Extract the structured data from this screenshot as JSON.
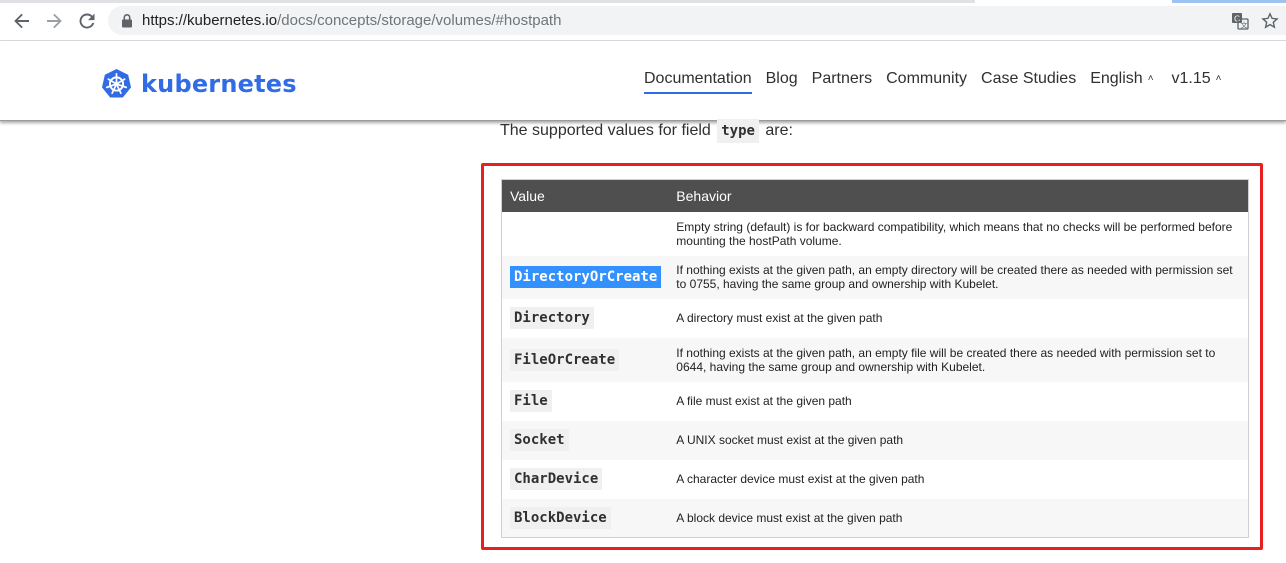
{
  "browser": {
    "url_host": "https://kubernetes.io",
    "url_path": "/docs/concepts/storage/volumes/#hostpath",
    "icons": [
      "back-arrow-icon",
      "forward-arrow-icon",
      "reload-icon",
      "lock-icon",
      "translate-icon",
      "star-icon"
    ]
  },
  "site": {
    "logo_text": "kubernetes",
    "nav": [
      {
        "label": "Documentation",
        "active": true
      },
      {
        "label": "Blog"
      },
      {
        "label": "Partners"
      },
      {
        "label": "Community"
      },
      {
        "label": "Case Studies"
      },
      {
        "label": "English",
        "caret": "˄"
      },
      {
        "label": "v1.15",
        "caret": "˄"
      }
    ],
    "brand_color": "#326ce5"
  },
  "content": {
    "intro_before": "The supported values for field ",
    "intro_code": "type",
    "intro_after": " are:",
    "table": {
      "headers": [
        "Value",
        "Behavior"
      ],
      "rows": [
        {
          "value": "",
          "behavior": "Empty string (default) is for backward compatibility, which means that no checks will be performed before mounting the hostPath volume."
        },
        {
          "value": "DirectoryOrCreate",
          "behavior": "If nothing exists at the given path, an empty directory will be created there as needed with permission set to 0755, having the same group and ownership with Kubelet.",
          "selected": true
        },
        {
          "value": "Directory",
          "behavior": "A directory must exist at the given path"
        },
        {
          "value": "FileOrCreate",
          "behavior": "If nothing exists at the given path, an empty file will be created there as needed with permission set to 0644, having the same group and ownership with Kubelet."
        },
        {
          "value": "File",
          "behavior": "A file must exist at the given path"
        },
        {
          "value": "Socket",
          "behavior": "A UNIX socket must exist at the given path"
        },
        {
          "value": "CharDevice",
          "behavior": "A character device must exist at the given path"
        },
        {
          "value": "BlockDevice",
          "behavior": "A block device must exist at the given path"
        }
      ]
    },
    "annotation_color": "#e8211e"
  }
}
